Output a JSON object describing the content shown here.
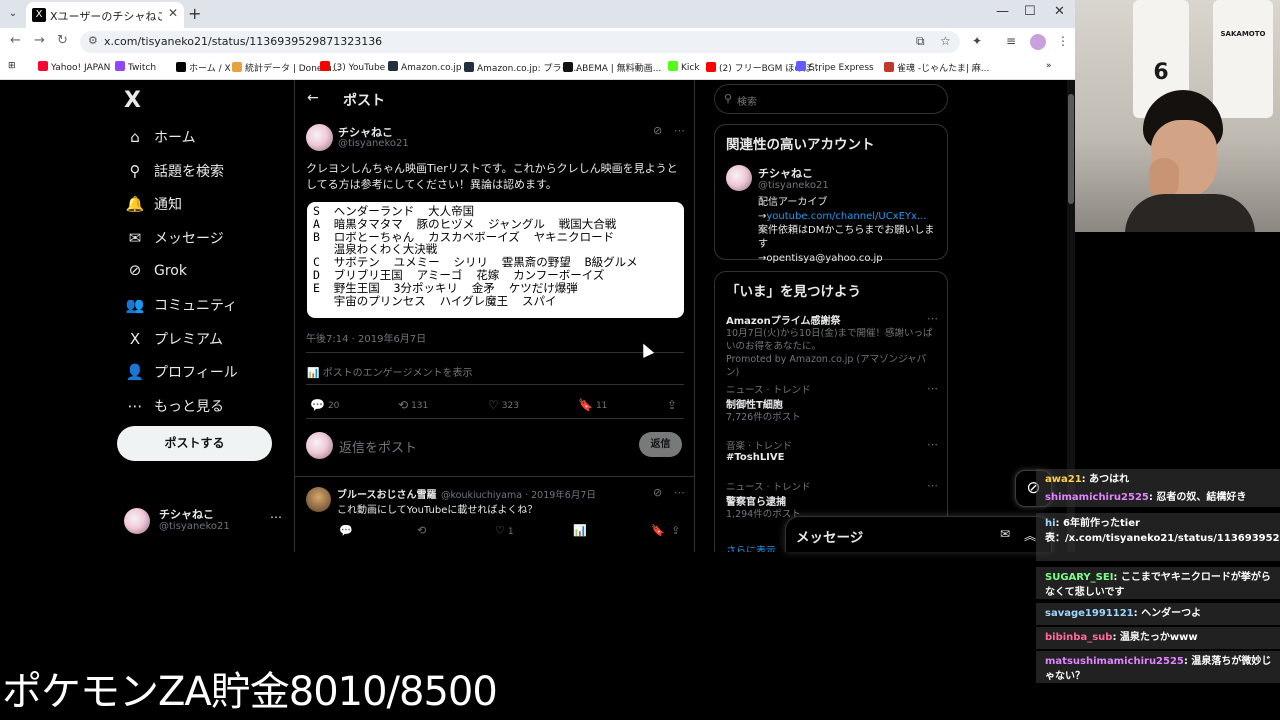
{
  "browser": {
    "tab_title": "Xユーザーのチシャねこさん: 「クレヨン",
    "url": "x.com/tisyaneko21/status/1136939529871323136",
    "bookmarks": [
      {
        "label": "Yahoo! JAPAN",
        "color": "#ff0033"
      },
      {
        "label": "Twitch",
        "color": "#9146ff"
      },
      {
        "label": "ホーム / X",
        "color": "#000000"
      },
      {
        "label": "統計データ | Doneru...",
        "color": "#e6a23c"
      },
      {
        "label": "(3) YouTube",
        "color": "#ff0000"
      },
      {
        "label": "Amazon.co.jp",
        "color": "#232f3e"
      },
      {
        "label": "Amazon.co.jp: プライ...",
        "color": "#232f3e"
      },
      {
        "label": "ABEMA | 無料動画...",
        "color": "#111111"
      },
      {
        "label": "Kick",
        "color": "#53fc18"
      },
      {
        "label": "(2) フリーBGM ほのぼ...",
        "color": "#ff0000"
      },
      {
        "label": "Stripe Express",
        "color": "#635bff"
      },
      {
        "label": "雀魂 -じゃんたま| 麻...",
        "color": "#c0392b"
      }
    ]
  },
  "sidebar": {
    "logo": "X",
    "items": [
      {
        "label": "ホーム",
        "icon": "⌂"
      },
      {
        "label": "話題を検索",
        "icon": "⚲"
      },
      {
        "label": "通知",
        "icon": "🔔"
      },
      {
        "label": "メッセージ",
        "icon": "✉"
      },
      {
        "label": "Grok",
        "icon": "⊘"
      },
      {
        "label": "コミュニティ",
        "icon": "👥"
      },
      {
        "label": "プレミアム",
        "icon": "X"
      },
      {
        "label": "プロフィール",
        "icon": "👤"
      },
      {
        "label": "もっと見る",
        "icon": "⋯"
      }
    ],
    "post_button": "ポストする",
    "account": {
      "name": "チシャねこ",
      "handle": "@tisyaneko21"
    }
  },
  "main": {
    "header_title": "ポスト",
    "post": {
      "author_name": "チシャねこ",
      "author_handle": "@tisyaneko21",
      "text": "クレヨンしんちゃん映画Tierリストです。これからクレしん映画を見ようとしてる方は参考にしてください！異論は認めます。",
      "tier_lines": [
        "S  ヘンダーランド  大人帝国",
        "A  暗黒タマタマ  豚のヒヅメ  ジャングル  戦国大合戦",
        "B  ロボとーちゃん  カスカベボーイズ  ヤキニクロード",
        "   温泉わくわく大決戦",
        "C  サボテン  ユメミー  シリリ  雲黒斎の野望  B級グルメ",
        "D  ブリブリ王国  アミーゴ  花嫁  カンフーボーイズ",
        "E  野生王国  3分ポッキリ  金矛  ケツだけ爆弾",
        "   宇宙のプリンセス  ハイグレ魔王  スパイ"
      ],
      "timestamp": "午後7:14 · 2019年6月7日",
      "engagement_link": "ポストのエンゲージメントを表示",
      "stats": {
        "replies": "20",
        "reposts": "131",
        "likes": "323",
        "bookmarks": "11"
      }
    },
    "reply_box": {
      "placeholder": "返信をポスト",
      "button": "返信"
    },
    "reply": {
      "name": "ブルースおじさん雪羅",
      "meta": "@koukiuchiyama · 2019年6月7日",
      "text": "これ動画にしてYouTubeに載せればよくね？",
      "likes": "1"
    }
  },
  "right": {
    "search_placeholder": "検索",
    "related": {
      "title": "関連性の高いアカウント",
      "name": "チシャねこ",
      "handle": "@tisyaneko21",
      "bio_1": "配信アーカイブ",
      "bio_arrow": "→",
      "bio_link": "youtube.com/channel/UCxEYx...",
      "bio_2": " 案件依頼はDMかこちらまでお願いします",
      "bio_3": "→opentisya@yahoo.co.jp"
    },
    "trends": {
      "title": "「いま」を見つけよう",
      "items": [
        {
          "category": "",
          "name": "Amazonプライム感謝祭",
          "sub": "10月7日(火)から10日(金)まで開催！感謝いっぱいのお得をあなたに。",
          "promo": "Promoted by Amazon.co.jp (アマゾンジャパン)"
        },
        {
          "category": "ニュース · トレンド",
          "name": "制御性T細胞",
          "sub": "7,726件のポスト"
        },
        {
          "category": "音楽 · トレンド",
          "name": "#ToshLIVE",
          "sub": ""
        },
        {
          "category": "ニュース · トレンド",
          "name": "警察官ら逮捕",
          "sub": "1,294件のポスト"
        }
      ],
      "show_more": "さらに表示"
    }
  },
  "messages_drawer": {
    "title": "メッセージ"
  },
  "webcam": {
    "jersey_left": "6",
    "jersey_right": "SAKAMOTO"
  },
  "chat": [
    {
      "user": "awa21",
      "user_color": "#ffd24a",
      "text": "あつはれ"
    },
    {
      "user": "shimamichiru2525",
      "user_color": "#e184ff",
      "text": "忍者の奴、結構好き"
    },
    {
      "user": "hi",
      "user_color": "#9fd7ff",
      "text": "6年前作ったtier表：/x.com/tisyaneko21/status/1136939529871323136"
    },
    {
      "user": "SUGARY_SEI",
      "user_color": "#7cff8a",
      "text": "ここまでヤキニクロードが挙がらなくて悲しいです"
    },
    {
      "user": "savage1991121",
      "user_color": "#9fd7ff",
      "text": "ヘンダーつよ"
    },
    {
      "user": "bibinba_sub",
      "user_color": "#ff6b9a",
      "text": "温泉たっかwww"
    },
    {
      "user": "matsushimamichiru2525",
      "user_color": "#e184ff",
      "text": "温泉落ちが微妙じゃない？"
    }
  ],
  "overlay": {
    "text": "ポケモンZA貯金8010/8500"
  }
}
